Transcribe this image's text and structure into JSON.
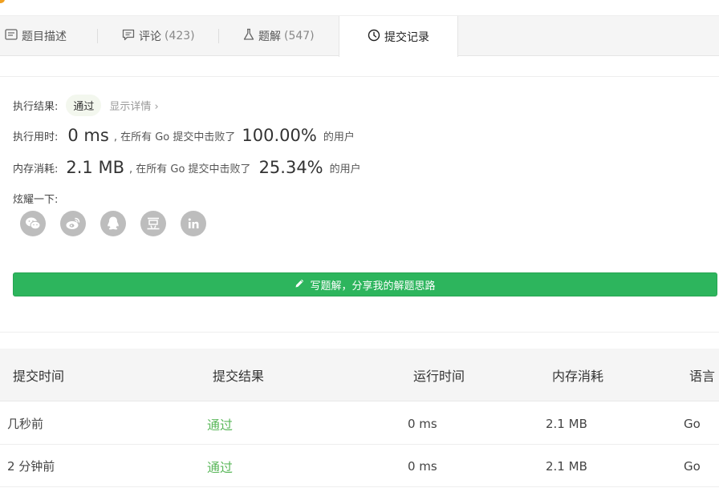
{
  "tabs": [
    {
      "label": "题目描述",
      "count": "",
      "icon": "description-icon"
    },
    {
      "label": "评论",
      "count": "(423)",
      "icon": "comment-icon"
    },
    {
      "label": "题解",
      "count": "(547)",
      "icon": "flask-icon"
    },
    {
      "label": "提交记录",
      "count": "",
      "icon": "clock-icon"
    }
  ],
  "result": {
    "label": "执行结果:",
    "status": "通过",
    "detail_link": "显示详情 ›"
  },
  "runtime": {
    "label": "执行用时:",
    "value": "0 ms",
    "mid": ", 在所有 Go 提交中击败了",
    "percent": "100.00%",
    "suffix": "的用户"
  },
  "memory": {
    "label": "内存消耗:",
    "value": "2.1 MB",
    "mid": ", 在所有 Go 提交中击败了",
    "percent": "25.34%",
    "suffix": "的用户"
  },
  "share": {
    "label": "炫耀一下:",
    "icons": [
      "wechat-icon",
      "weibo-icon",
      "qq-icon",
      "douban-icon",
      "linkedin-icon"
    ],
    "glyphs": [
      "◕",
      "◉",
      "♟",
      "豆",
      "in"
    ]
  },
  "write_button": {
    "label": "写题解，分享我的解题思路",
    "icon": "pencil-icon"
  },
  "table": {
    "headers": [
      "提交时间",
      "提交结果",
      "运行时间",
      "内存消耗",
      "语言"
    ],
    "rows": [
      [
        "几秒前",
        "通过",
        "0 ms",
        "2.1 MB",
        "Go"
      ],
      [
        "2 分钟前",
        "通过",
        "0 ms",
        "2.1 MB",
        "Go"
      ]
    ]
  },
  "colors": {
    "accent_green": "#2db55d",
    "pass_text": "#5cb85c",
    "icon_grey": "#bdbdbd"
  }
}
